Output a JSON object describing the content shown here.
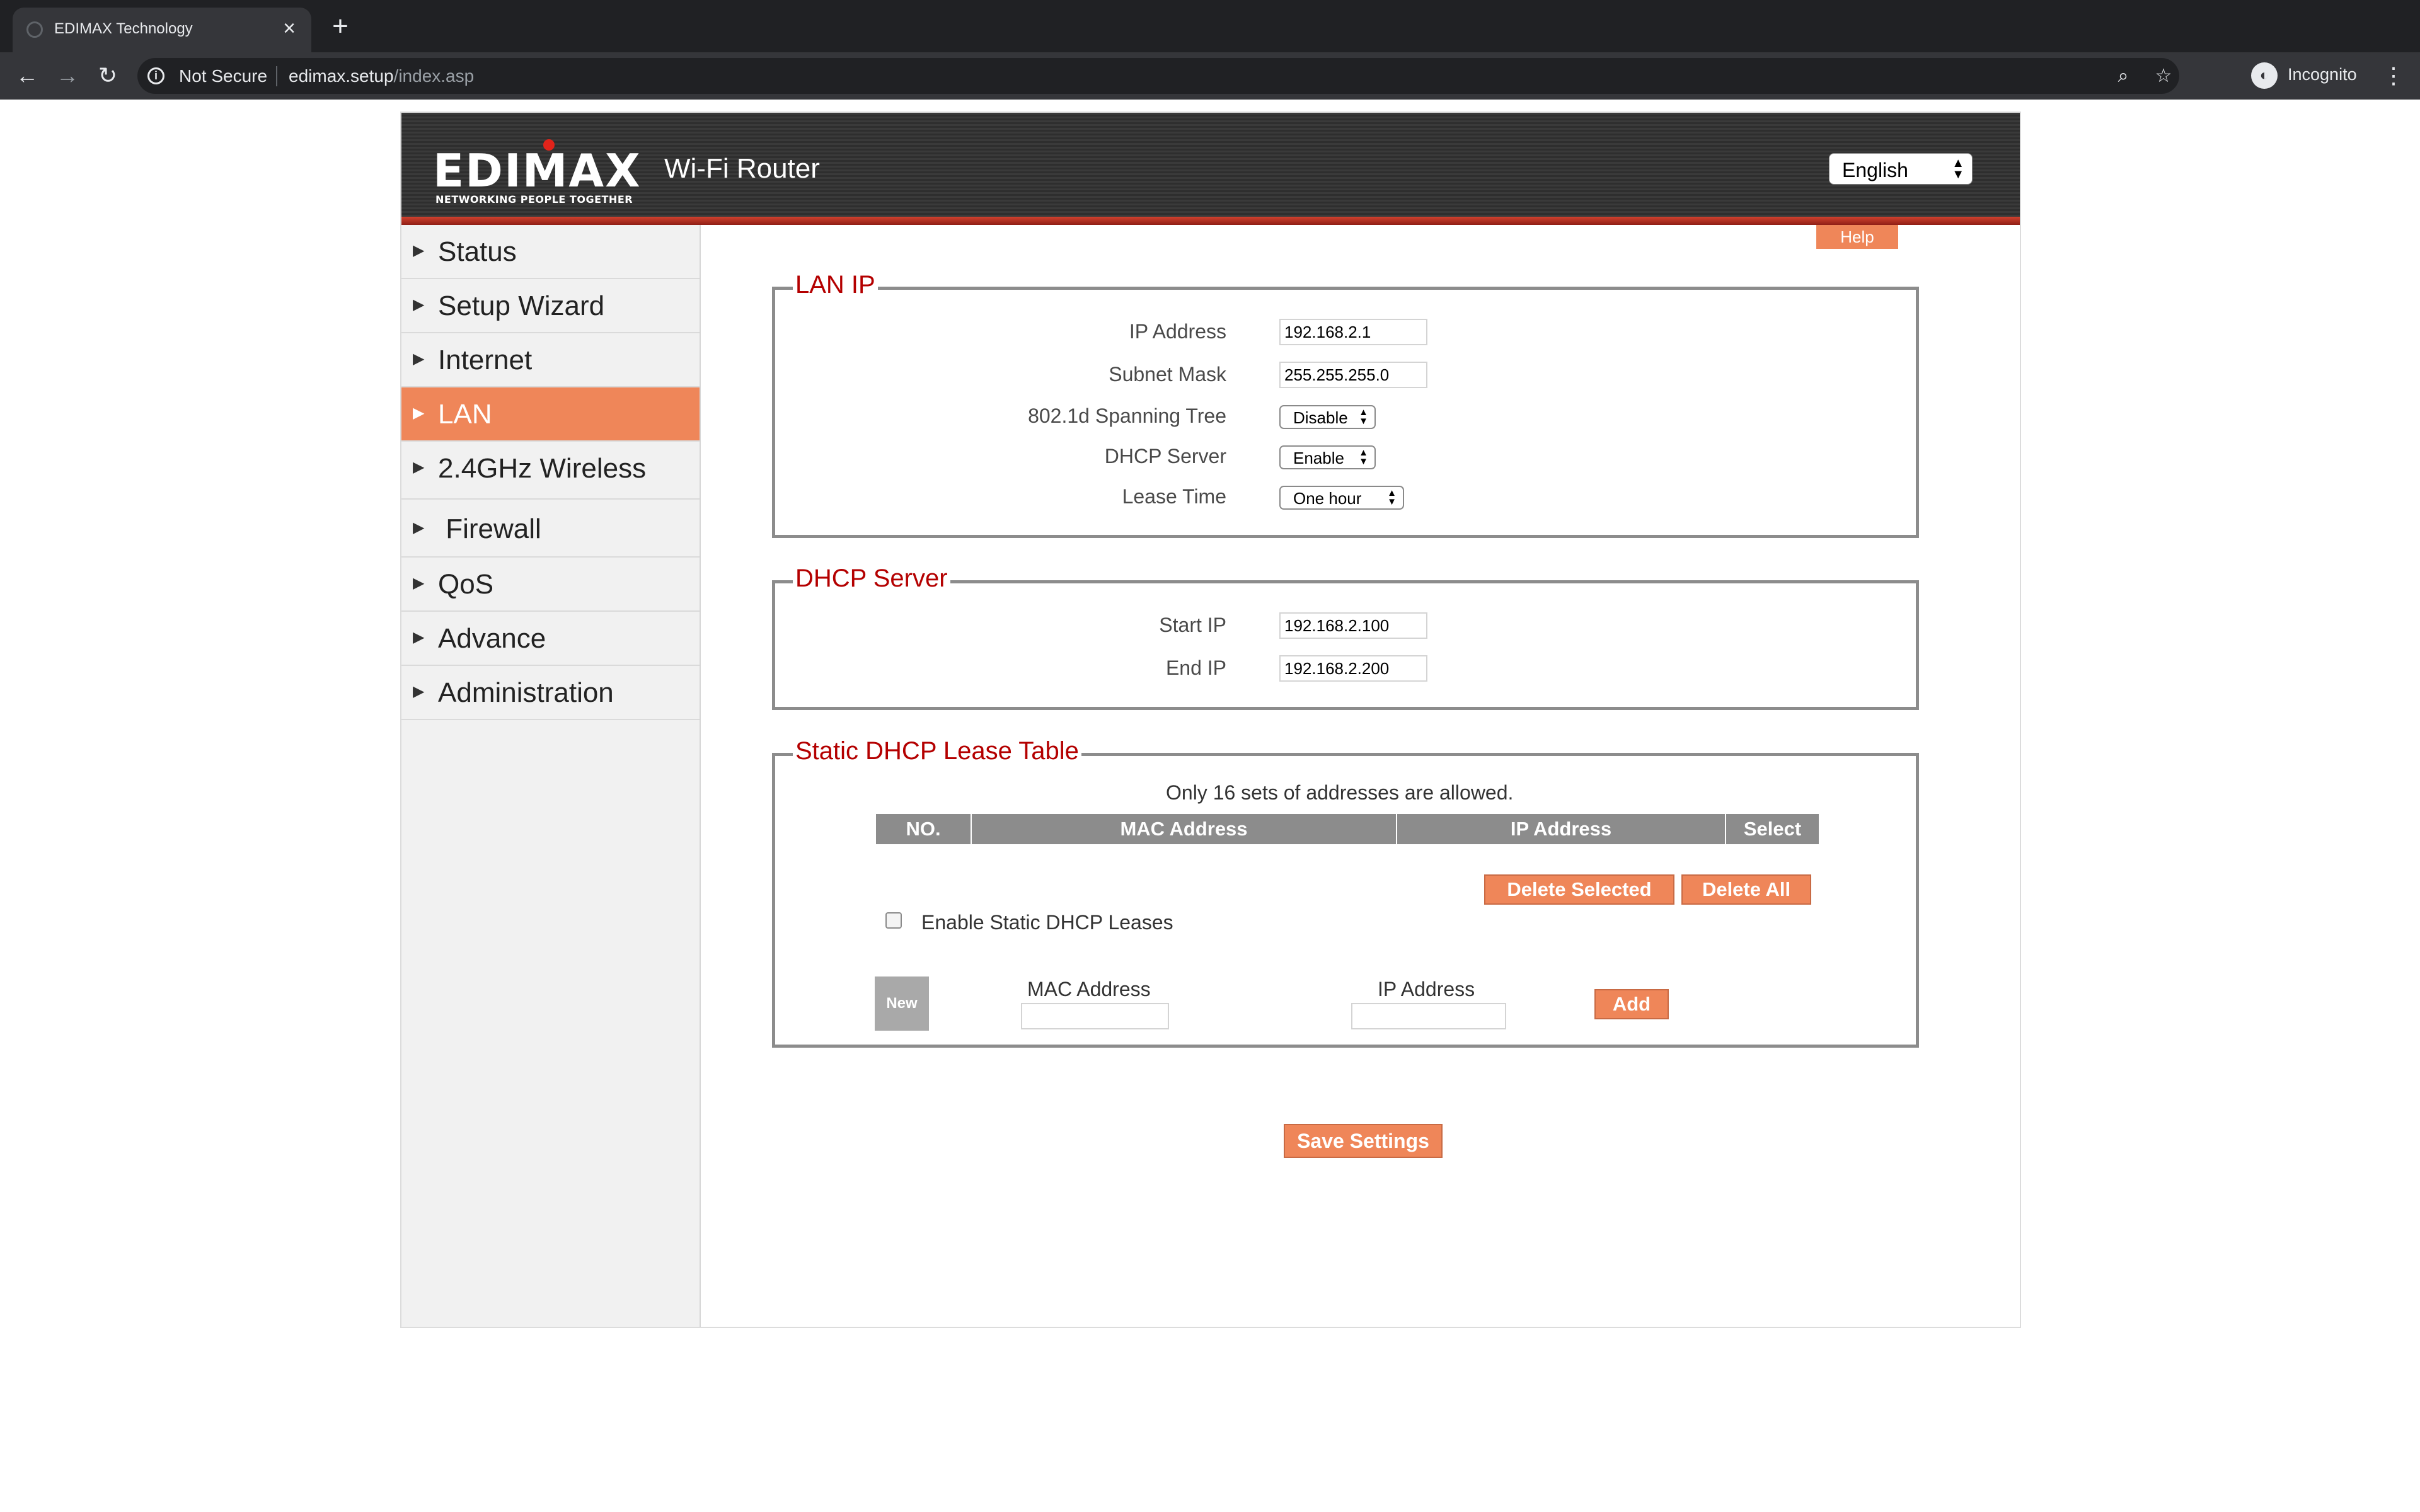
{
  "browser": {
    "tab_title": "EDIMAX Technology",
    "tab_close": "×",
    "new_tab": "+",
    "back": "←",
    "forward": "→",
    "reload": "↻",
    "security_icon": "i",
    "security_label": "Not Secure",
    "url_host": "edimax.setup",
    "url_path": "/index.asp",
    "zoom_icon": "⌕",
    "bookmark_icon": "☆",
    "profile_icon": "◐",
    "profile_label": "Incognito",
    "menu_icon": "⋮"
  },
  "header": {
    "logo_text": "EDIMAX",
    "logo_tagline": "NETWORKING PEOPLE TOGETHER",
    "title": "Wi-Fi Router",
    "language": "English",
    "select_arrows": "▲▼"
  },
  "sidebar": {
    "marker": "▶",
    "items": [
      {
        "label": "Status"
      },
      {
        "label": "Setup Wizard"
      },
      {
        "label": "Internet"
      },
      {
        "label": "LAN"
      },
      {
        "label": "2.4GHz Wireless"
      },
      {
        "label": " Firewall"
      },
      {
        "label": "QoS"
      },
      {
        "label": "Advance"
      },
      {
        "label": "Administration"
      }
    ],
    "active_index": 3
  },
  "help_label": "Help",
  "lan_ip": {
    "legend": "LAN IP",
    "ip_label": "IP Address",
    "ip_value": "192.168.2.1",
    "mask_label": "Subnet Mask",
    "mask_value": "255.255.255.0",
    "stp_label": "802.1d Spanning Tree",
    "stp_value": "Disable",
    "dhcp_label": "DHCP Server",
    "dhcp_value": "Enable",
    "lease_label": "Lease Time",
    "lease_value": "One hour"
  },
  "dhcp_server": {
    "legend": "DHCP Server",
    "start_label": "Start IP",
    "start_value": "192.168.2.100",
    "end_label": "End IP",
    "end_value": "192.168.2.200"
  },
  "static_table": {
    "legend": "Static DHCP Lease Table",
    "note": "Only 16 sets of addresses are allowed.",
    "columns": [
      "NO.",
      "MAC Address",
      "IP Address",
      "Select"
    ],
    "delete_selected": "Delete Selected",
    "delete_all": "Delete All",
    "enable_label": "Enable Static DHCP Leases",
    "enable_checked": false,
    "new_label": "New",
    "mac_label": "MAC Address",
    "mac_value": "",
    "ip_label": "IP Address",
    "ip_value": "",
    "add_label": "Add"
  },
  "save_label": "Save Settings"
}
